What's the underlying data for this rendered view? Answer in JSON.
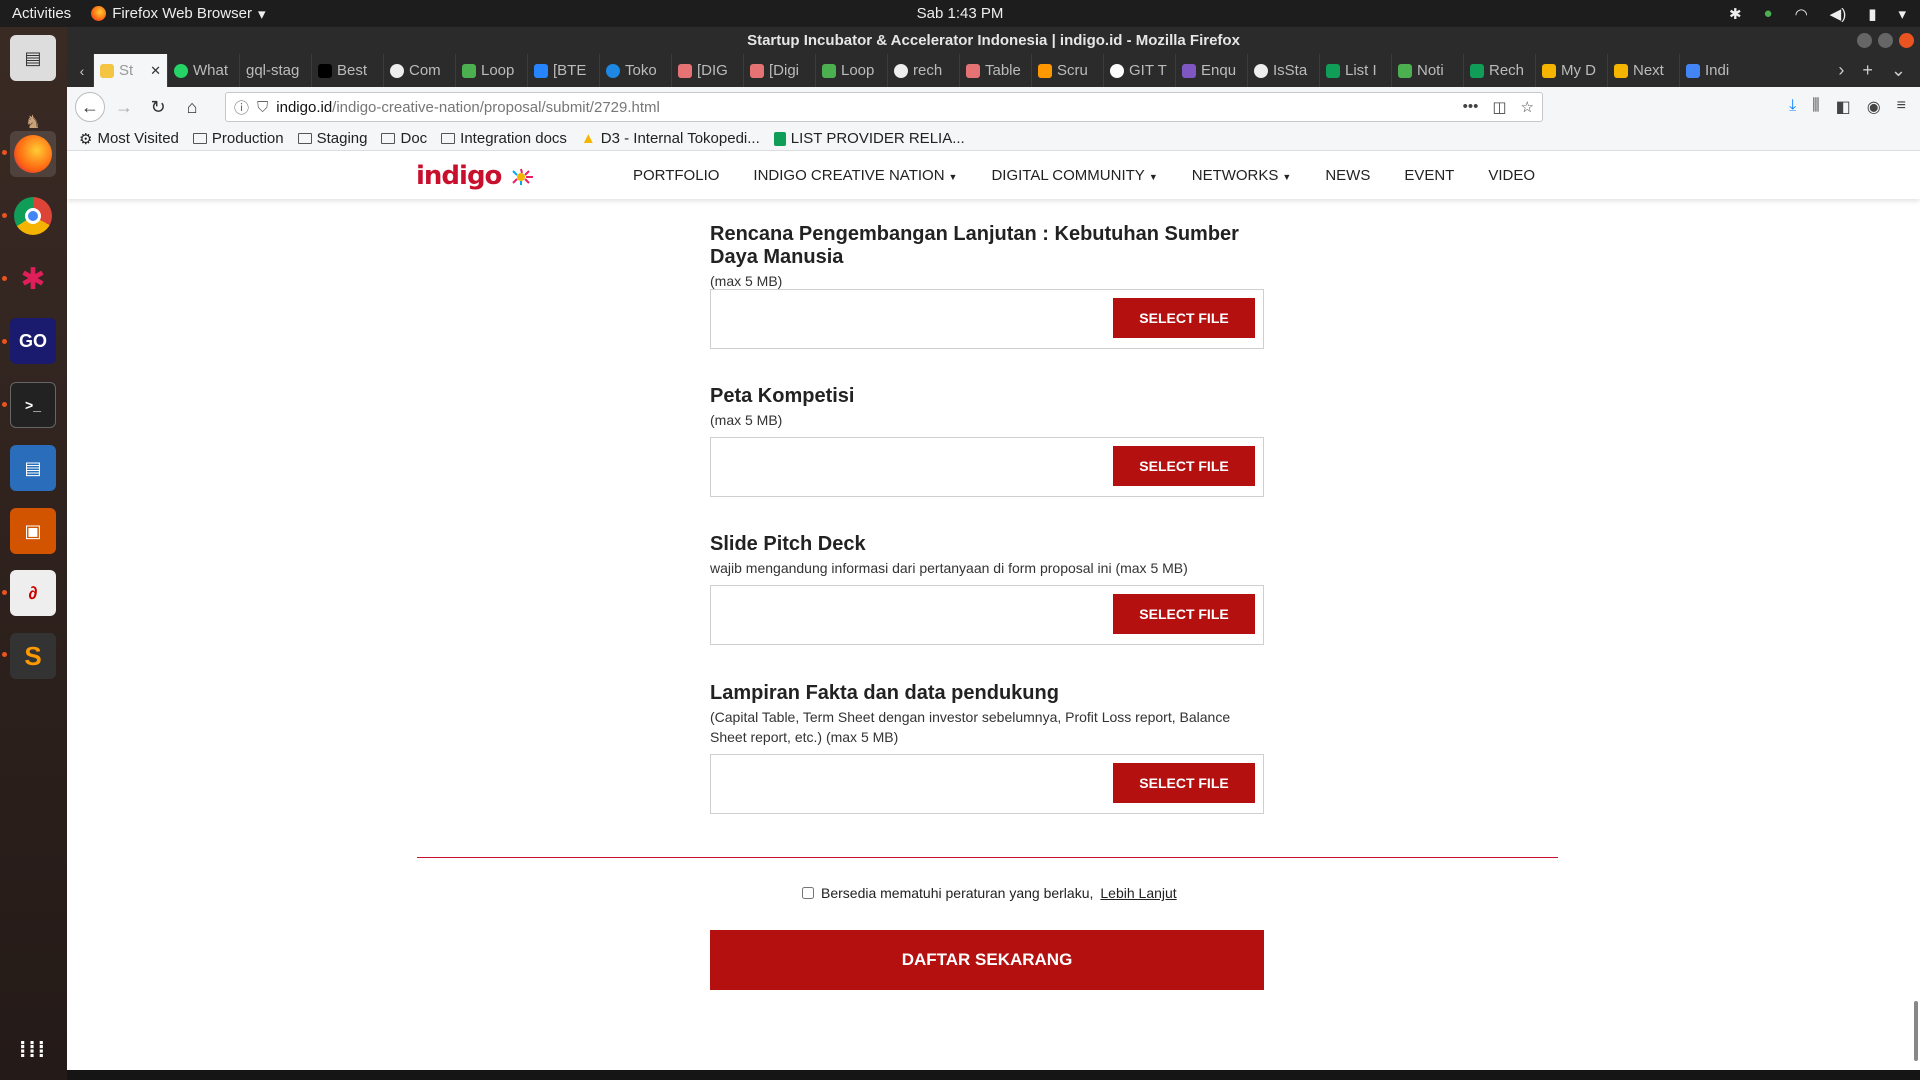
{
  "topbar": {
    "activities": "Activities",
    "app_name": "Firefox Web Browser",
    "clock": "Sab   1:43 PM"
  },
  "window": {
    "title": "Startup Incubator & Accelerator Indonesia | indigo.id - Mozilla Firefox"
  },
  "tabs": [
    {
      "label": "St",
      "active": true
    },
    {
      "label": "What"
    },
    {
      "label": "gql-stag"
    },
    {
      "label": "Best"
    },
    {
      "label": "Com"
    },
    {
      "label": "Loop"
    },
    {
      "label": "[BTE"
    },
    {
      "label": "Toko"
    },
    {
      "label": "[DIG"
    },
    {
      "label": "[Digi"
    },
    {
      "label": "Loop"
    },
    {
      "label": "rech"
    },
    {
      "label": "Table"
    },
    {
      "label": "Scru"
    },
    {
      "label": "GIT T"
    },
    {
      "label": "Enqu"
    },
    {
      "label": "IsSta"
    },
    {
      "label": "List I"
    },
    {
      "label": "Noti"
    },
    {
      "label": "Rech"
    },
    {
      "label": "My D"
    },
    {
      "label": "Next"
    },
    {
      "label": "Indi"
    }
  ],
  "url": {
    "host": "indigo.id",
    "path": "/indigo-creative-nation/proposal/submit/2729.html"
  },
  "bookmarks": [
    {
      "label": "Most Visited",
      "icon": "gear-icon"
    },
    {
      "label": "Production",
      "icon": "folder-icon"
    },
    {
      "label": "Staging",
      "icon": "folder-icon"
    },
    {
      "label": "Doc",
      "icon": "folder-icon"
    },
    {
      "label": "Integration docs",
      "icon": "folder-icon"
    },
    {
      "label": "D3 - Internal Tokopedi...",
      "icon": "drive-icon"
    },
    {
      "label": "LIST PROVIDER RELIA...",
      "icon": "sheets-icon"
    }
  ],
  "site": {
    "logo": "indigo",
    "menu": [
      {
        "label": "PORTFOLIO",
        "dropdown": false
      },
      {
        "label": "INDIGO CREATIVE NATION",
        "dropdown": true
      },
      {
        "label": "DIGITAL COMMUNITY",
        "dropdown": true
      },
      {
        "label": "NETWORKS",
        "dropdown": true
      },
      {
        "label": "NEWS",
        "dropdown": false
      },
      {
        "label": "EVENT",
        "dropdown": false
      },
      {
        "label": "VIDEO",
        "dropdown": false
      }
    ]
  },
  "form": {
    "fields": [
      {
        "title": "Rencana Pengembangan Lanjutan : Kebutuhan Sumber Daya Manusia",
        "hint": "(max 5 MB)",
        "button": "SELECT FILE"
      },
      {
        "title": "Peta Kompetisi",
        "hint": "(max 5 MB)",
        "button": "SELECT FILE"
      },
      {
        "title": "Slide Pitch Deck",
        "hint": "wajib mengandung informasi dari pertanyaan di form proposal ini (max 5 MB)",
        "button": "SELECT FILE"
      },
      {
        "title": "Lampiran Fakta dan data pendukung",
        "hint": "(Capital Table, Term Sheet dengan investor sebelumnya, Profit Loss report, Balance Sheet report, etc.) (max 5 MB)",
        "button": "SELECT FILE"
      }
    ],
    "agree_text": "Bersedia mematuhi peraturan yang berlaku,",
    "agree_link": "Lebih Lanjut",
    "submit": "DAFTAR SEKARANG"
  },
  "colors": {
    "brand_red": "#b3100f",
    "divider": "#c8102e"
  }
}
